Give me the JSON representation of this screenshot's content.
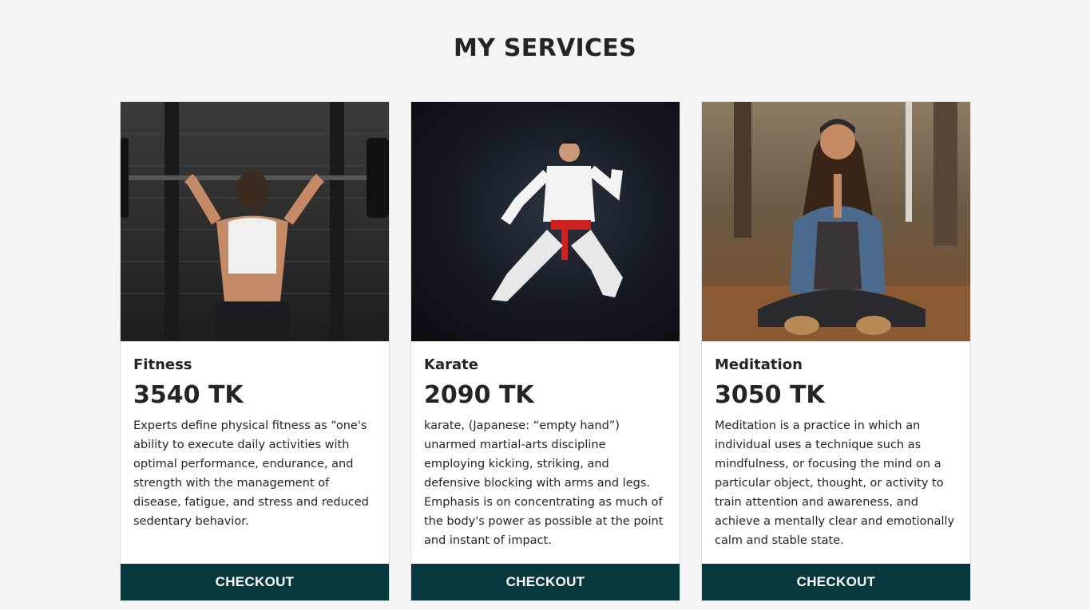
{
  "page": {
    "title": "MY SERVICES"
  },
  "services": [
    {
      "name": "Fitness",
      "price": "3540 TK",
      "description": "Experts define physical fitness as “one's ability to execute daily activities with optimal performance, endurance, and strength with the management of disease, fatigue, and stress and reduced sedentary behavior.",
      "button_label": "CHECKOUT",
      "image_icon": "weightlifting-photo"
    },
    {
      "name": "Karate",
      "price": "2090 TK",
      "description": "karate, (Japanese: “empty hand”) unarmed martial-arts discipline employing kicking, striking, and defensive blocking with arms and legs. Emphasis is on concentrating as much of the body's power as possible at the point and instant of impact.",
      "button_label": "CHECKOUT",
      "image_icon": "karate-photo"
    },
    {
      "name": "Meditation",
      "price": "3050 TK",
      "description": "Meditation is a practice in which an individual uses a technique such as mindfulness, or focusing the mind on a particular object, thought, or activity to train attention and awareness, and achieve a mentally clear and emotionally calm and stable state.",
      "button_label": "CHECKOUT",
      "image_icon": "meditation-photo"
    }
  ],
  "colors": {
    "background": "#f5f5f5",
    "button": "#08393e",
    "card": "#ffffff"
  }
}
